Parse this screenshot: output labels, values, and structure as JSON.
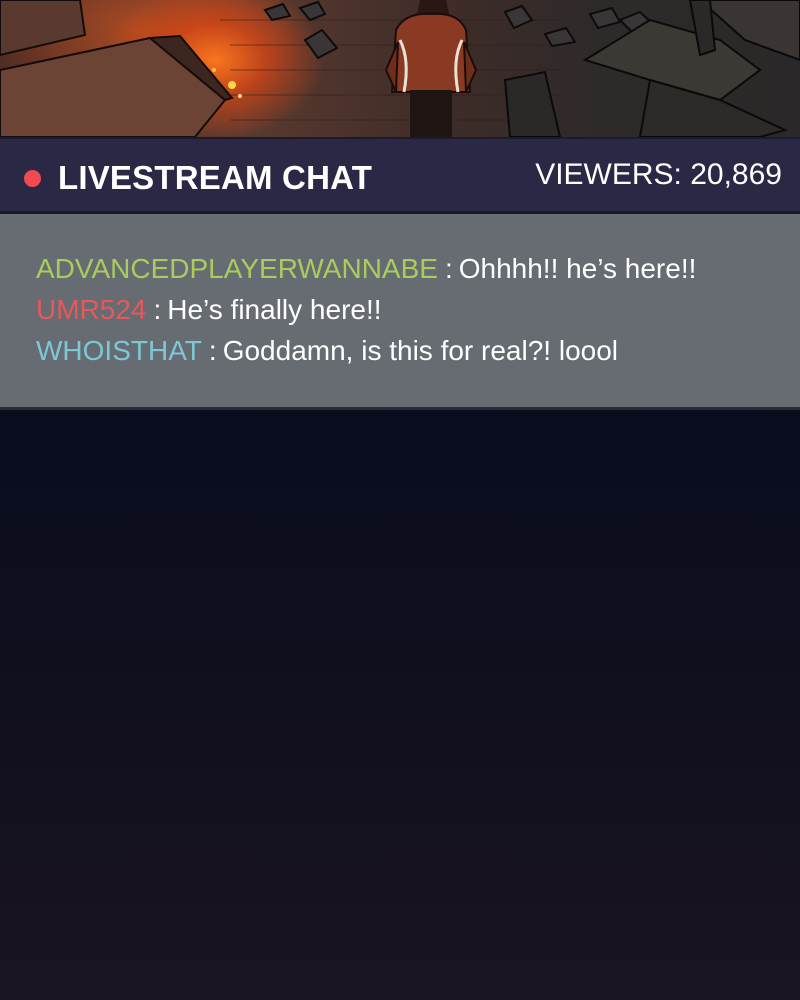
{
  "header": {
    "title": "LIVESTREAM CHAT",
    "viewers": "VIEWERS: 20,869",
    "live_indicator_color": "#f24a50"
  },
  "chat": {
    "separator": ":",
    "messages": [
      {
        "user": "ADVANCEDPLAYERWANNABE",
        "user_color": "#a9cc5c",
        "text": "Ohhhh!! he’s here!!"
      },
      {
        "user": "UMR524",
        "user_color": "#e8585a",
        "text": "He’s finally here!!"
      },
      {
        "user": "WHOISTHAT",
        "user_color": "#7cc8d6",
        "text": "Goddamn, is this for real?! loool"
      }
    ]
  }
}
